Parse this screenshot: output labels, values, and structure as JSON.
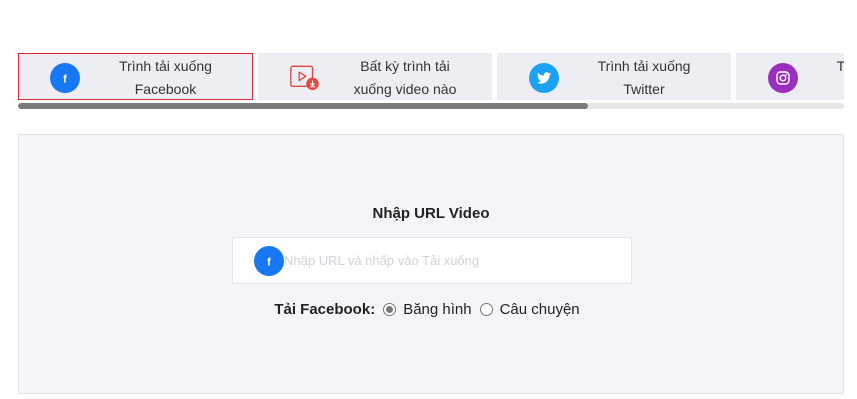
{
  "tabs": [
    {
      "label": "Trình tải xuống\nFacebook",
      "icon": "facebook-icon",
      "active": true
    },
    {
      "label": "Bất kỳ trình tải\nxuống video nào",
      "icon": "video-download-icon",
      "active": false
    },
    {
      "label": "Trình tải xuống\nTwitter",
      "icon": "twitter-icon",
      "active": false
    },
    {
      "label": "Trình tải xuống\nInstagram",
      "icon": "instagram-icon",
      "active": false
    }
  ],
  "colors": {
    "facebook": "#1877f2",
    "twitter": "#1da1f2",
    "instagram": "#9a2fbf",
    "video": "#e8453c",
    "active_border": "#d9262c"
  },
  "scroll": {
    "position": 0.69
  },
  "main": {
    "title": "Nhập URL Video",
    "url_input": {
      "value": "",
      "placeholder": "Nhập URL và nhấp vào Tải xuống"
    },
    "download_type": {
      "label": "Tải Facebook:",
      "options": [
        {
          "label": "Băng hình",
          "checked": true
        },
        {
          "label": "Câu chuyện",
          "checked": false
        }
      ]
    }
  }
}
